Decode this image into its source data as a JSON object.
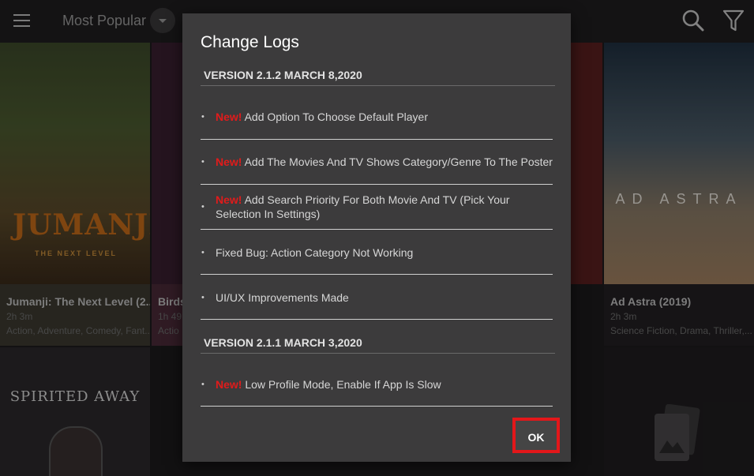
{
  "topbar": {
    "sort_label": "Most Popular",
    "icons": [
      "menu-icon",
      "dropdown-arrow-icon",
      "search-icon",
      "filter-icon"
    ]
  },
  "cards": [
    {
      "title": "Jumanji: The Next Level (2...",
      "duration": "2h 3m",
      "genres": "Action, Adventure, Comedy, Fant...",
      "logo": "JUMANJI",
      "logo_sub": "THE NEXT LEVEL"
    },
    {
      "title": "Birds",
      "duration": "1h 49",
      "genres": "Actio"
    },
    {
      "title": "Ad Astra (2019)",
      "duration": "2h 3m",
      "genres": "Science Fiction, Drama, Thriller,...",
      "logo": "AD ASTRA"
    },
    {
      "logo": "SPIRITED AWAY"
    }
  ],
  "dialog": {
    "title": "Change Logs",
    "versions": [
      {
        "label": "VERSION 2.1.2   MARCH 8,2020",
        "items": [
          {
            "tag": "New!",
            "text": " Add Option To Choose Default Player"
          },
          {
            "tag": "New!",
            "text": " Add The Movies And TV Shows Category/Genre To The Poster"
          },
          {
            "tag": "New!",
            "text": " Add Search Priority For Both Movie And TV (Pick Your Selection In Settings)"
          },
          {
            "tag": "",
            "text": "Fixed Bug: Action Category Not Working"
          },
          {
            "tag": "",
            "text": "UI/UX Improvements Made"
          }
        ]
      },
      {
        "label": "VERSION 2.1.1   MARCH 3,2020",
        "items": [
          {
            "tag": "New!",
            "text": " Low Profile Mode, Enable If App Is Slow"
          }
        ]
      }
    ],
    "ok_label": "OK"
  },
  "colors": {
    "accent_red": "#e3171a",
    "new_tag": "#e11b1b",
    "dialog_bg": "#3c3b3c",
    "app_bg": "#1d1b1d"
  }
}
